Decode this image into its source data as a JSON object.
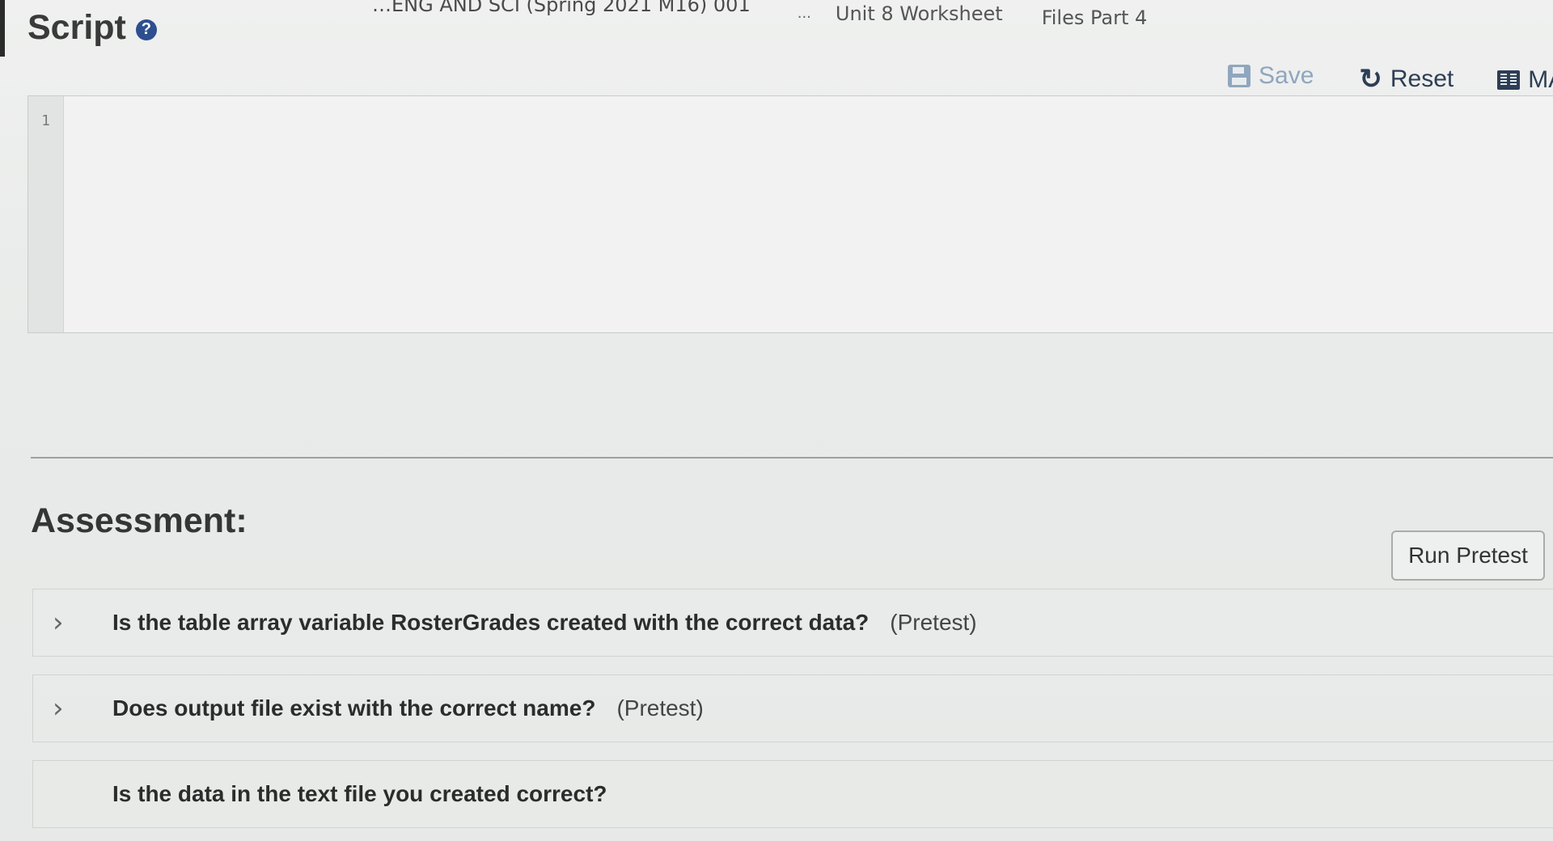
{
  "breadcrumb": {
    "course": "…ENG AND SCI (Spring 2021 M16) 001",
    "separator": "...",
    "unit": "Unit 8 Worksheet",
    "files": "Files Part 4"
  },
  "script": {
    "title": "Script",
    "help_icon": "?"
  },
  "toolbar": {
    "save_label": "Save",
    "reset_label": "Reset",
    "ma_label": "MA"
  },
  "editor": {
    "line_numbers": [
      "1"
    ],
    "content": ""
  },
  "assessment": {
    "title": "Assessment:",
    "run_pretest_label": "Run Pretest",
    "tests": [
      {
        "question": "Is the table array variable RosterGrades created with the correct data?",
        "tag": "(Pretest)",
        "expandable": true
      },
      {
        "question": "Does output file exist with the correct name?",
        "tag": "(Pretest)",
        "expandable": true
      },
      {
        "question": "Is the data in the text file you created correct?",
        "tag": "",
        "expandable": false
      }
    ]
  },
  "colors": {
    "save_disabled": "#8fa6bf",
    "toolbar_text": "#2d3e55",
    "help_icon_bg": "#2d4f8f"
  },
  "icons": {
    "save": "save-icon",
    "reset": "reset-icon",
    "ma": "book-icon",
    "help": "help-icon",
    "expand": "chevron-right-icon"
  }
}
